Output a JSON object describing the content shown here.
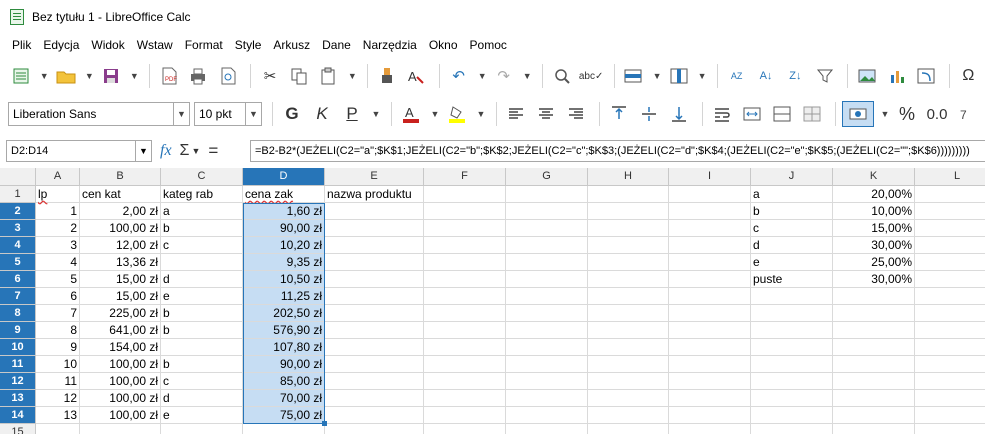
{
  "window": {
    "title": "Bez tytułu 1 - LibreOffice Calc"
  },
  "menu": [
    "Plik",
    "Edycja",
    "Widok",
    "Wstaw",
    "Format",
    "Style",
    "Arkusz",
    "Dane",
    "Narzędzia",
    "Okno",
    "Pomoc"
  ],
  "toolbar2": {
    "font_name": "Liberation Sans",
    "font_size": "10 pkt",
    "bold": "G",
    "italic": "K",
    "underline": "P",
    "percent": "%",
    "decimal": "0.0"
  },
  "formula_bar": {
    "name_box": "D2:D14",
    "formula": "=B2-B2*(JEŻELI(C2=\"a\";$K$1;JEŻELI(C2=\"b\";$K$2;JEŻELI(C2=\"c\";$K$3;(JEŻELI(C2=\"d\";$K$4;(JEŻELI(C2=\"e\";$K$5;(JEŻELI(C2=\"\";$K$6)))))))))"
  },
  "columns": [
    "A",
    "B",
    "C",
    "D",
    "E",
    "F",
    "G",
    "H",
    "I",
    "J",
    "K",
    "L"
  ],
  "rows": [
    "1",
    "2",
    "3",
    "4",
    "5",
    "6",
    "7",
    "8",
    "9",
    "10",
    "11",
    "12",
    "13",
    "14",
    "15"
  ],
  "headers": {
    "A1": "lp",
    "B1": "cen kat",
    "C1": "kateg rab",
    "D1": "cena zak",
    "E1": "nazwa produktu"
  },
  "table": [
    {
      "lp": "1",
      "cen_kat": "2,00 zł",
      "kat": "a",
      "cena": "1,60 zł"
    },
    {
      "lp": "2",
      "cen_kat": "100,00 zł",
      "kat": "b",
      "cena": "90,00 zł"
    },
    {
      "lp": "3",
      "cen_kat": "12,00 zł",
      "kat": "c",
      "cena": "10,20 zł"
    },
    {
      "lp": "4",
      "cen_kat": "13,36 zł",
      "kat": "",
      "cena": "9,35 zł"
    },
    {
      "lp": "5",
      "cen_kat": "15,00 zł",
      "kat": "d",
      "cena": "10,50 zł"
    },
    {
      "lp": "6",
      "cen_kat": "15,00 zł",
      "kat": "e",
      "cena": "11,25 zł"
    },
    {
      "lp": "7",
      "cen_kat": "225,00 zł",
      "kat": "b",
      "cena": "202,50 zł"
    },
    {
      "lp": "8",
      "cen_kat": "641,00 zł",
      "kat": "b",
      "cena": "576,90 zł"
    },
    {
      "lp": "9",
      "cen_kat": "154,00 zł",
      "kat": "",
      "cena": "107,80 zł"
    },
    {
      "lp": "10",
      "cen_kat": "100,00 zł",
      "kat": "b",
      "cena": "90,00 zł"
    },
    {
      "lp": "11",
      "cen_kat": "100,00 zł",
      "kat": "c",
      "cena": "85,00 zł"
    },
    {
      "lp": "12",
      "cen_kat": "100,00 zł",
      "kat": "d",
      "cena": "70,00 zł"
    },
    {
      "lp": "13",
      "cen_kat": "100,00 zł",
      "kat": "e",
      "cena": "75,00 zł"
    }
  ],
  "discounts": [
    {
      "label": "a",
      "value": "20,00%"
    },
    {
      "label": "b",
      "value": "10,00%"
    },
    {
      "label": "c",
      "value": "15,00%"
    },
    {
      "label": "d",
      "value": "30,00%"
    },
    {
      "label": "e",
      "value": "25,00%"
    },
    {
      "label": "puste",
      "value": "30,00%"
    }
  ],
  "colors": {
    "selection": "#2775b8",
    "selection_fill": "#c6ddf3",
    "font_color": "#c9211e",
    "highlight": "#ffff00"
  }
}
